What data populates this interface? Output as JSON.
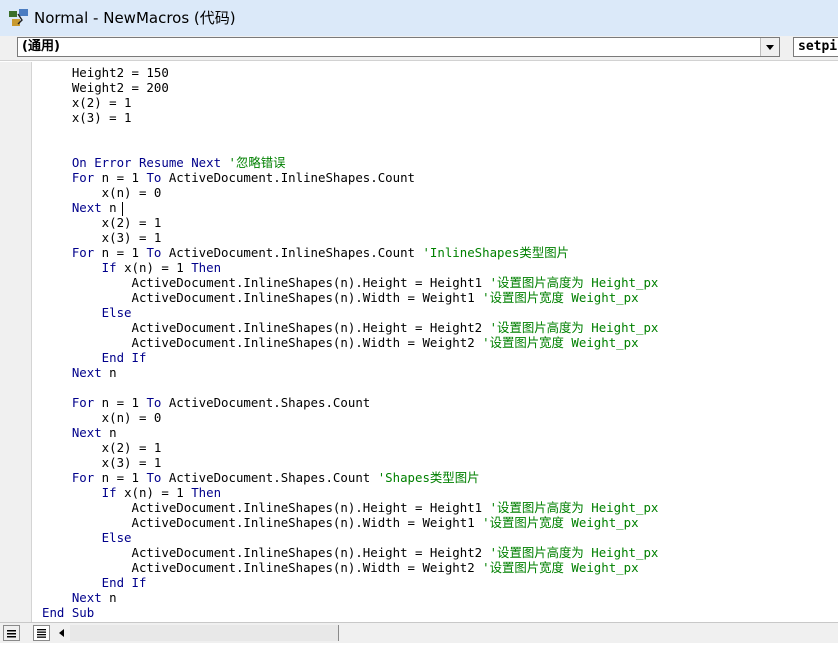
{
  "window": {
    "title": "Normal - NewMacros (代码)",
    "icon": "vba-module-icon"
  },
  "toolbar": {
    "object_combo": {
      "value": "(通用)",
      "icon": "dropdown-arrow-icon"
    },
    "procedure_combo": {
      "value": "setpi"
    }
  },
  "code": {
    "lines": [
      [
        {
          "t": "    Height2 = 150",
          "c": "n"
        }
      ],
      [
        {
          "t": "    Weight2 = 200",
          "c": "n"
        }
      ],
      [
        {
          "t": "    x(2) = 1",
          "c": "n"
        }
      ],
      [
        {
          "t": "    x(3) = 1",
          "c": "n"
        }
      ],
      [
        {
          "t": "",
          "c": "n"
        }
      ],
      [
        {
          "t": "",
          "c": "n"
        }
      ],
      [
        {
          "t": "    On Error Resume Next",
          "c": "k"
        },
        {
          "t": " '忽略错误",
          "c": "c"
        }
      ],
      [
        {
          "t": "    For",
          "c": "k"
        },
        {
          "t": " n = 1 ",
          "c": "n"
        },
        {
          "t": "To",
          "c": "k"
        },
        {
          "t": " ActiveDocument.InlineShapes.Count",
          "c": "n"
        }
      ],
      [
        {
          "t": "        x(n) = 0",
          "c": "n"
        }
      ],
      [
        {
          "t": "    Next",
          "c": "k"
        },
        {
          "t": " n",
          "c": "n"
        }
      ],
      [
        {
          "t": "        x(2) = 1",
          "c": "n"
        }
      ],
      [
        {
          "t": "        x(3) = 1",
          "c": "n"
        }
      ],
      [
        {
          "t": "    For",
          "c": "k"
        },
        {
          "t": " n = 1 ",
          "c": "n"
        },
        {
          "t": "To",
          "c": "k"
        },
        {
          "t": " ActiveDocument.InlineShapes.Count ",
          "c": "n"
        },
        {
          "t": "'InlineShapes类型图片",
          "c": "c"
        }
      ],
      [
        {
          "t": "        If",
          "c": "k"
        },
        {
          "t": " x(n) = 1 ",
          "c": "n"
        },
        {
          "t": "Then",
          "c": "k"
        }
      ],
      [
        {
          "t": "            ActiveDocument.InlineShapes(n).Height = Height1 ",
          "c": "n"
        },
        {
          "t": "'设置图片高度为 Height_px",
          "c": "c"
        }
      ],
      [
        {
          "t": "            ActiveDocument.InlineShapes(n).Width = Weight1 ",
          "c": "n"
        },
        {
          "t": "'设置图片宽度 Weight_px",
          "c": "c"
        }
      ],
      [
        {
          "t": "        Else",
          "c": "k"
        }
      ],
      [
        {
          "t": "            ActiveDocument.InlineShapes(n).Height = Height2 ",
          "c": "n"
        },
        {
          "t": "'设置图片高度为 Height_px",
          "c": "c"
        }
      ],
      [
        {
          "t": "            ActiveDocument.InlineShapes(n).Width = Weight2 ",
          "c": "n"
        },
        {
          "t": "'设置图片宽度 Weight_px",
          "c": "c"
        }
      ],
      [
        {
          "t": "        End If",
          "c": "k"
        }
      ],
      [
        {
          "t": "    Next",
          "c": "k"
        },
        {
          "t": " n",
          "c": "n"
        }
      ],
      [
        {
          "t": "",
          "c": "n"
        }
      ],
      [
        {
          "t": "    For",
          "c": "k"
        },
        {
          "t": " n = 1 ",
          "c": "n"
        },
        {
          "t": "To",
          "c": "k"
        },
        {
          "t": " ActiveDocument.Shapes.Count",
          "c": "n"
        }
      ],
      [
        {
          "t": "        x(n) = 0",
          "c": "n"
        }
      ],
      [
        {
          "t": "    Next",
          "c": "k"
        },
        {
          "t": " n",
          "c": "n"
        }
      ],
      [
        {
          "t": "        x(2) = 1",
          "c": "n"
        }
      ],
      [
        {
          "t": "        x(3) = 1",
          "c": "n"
        }
      ],
      [
        {
          "t": "    For",
          "c": "k"
        },
        {
          "t": " n = 1 ",
          "c": "n"
        },
        {
          "t": "To",
          "c": "k"
        },
        {
          "t": " ActiveDocument.Shapes.Count ",
          "c": "n"
        },
        {
          "t": "'Shapes类型图片",
          "c": "c"
        }
      ],
      [
        {
          "t": "        If",
          "c": "k"
        },
        {
          "t": " x(n) = 1 ",
          "c": "n"
        },
        {
          "t": "Then",
          "c": "k"
        }
      ],
      [
        {
          "t": "            ActiveDocument.InlineShapes(n).Height = Height1 ",
          "c": "n"
        },
        {
          "t": "'设置图片高度为 Height_px",
          "c": "c"
        }
      ],
      [
        {
          "t": "            ActiveDocument.InlineShapes(n).Width = Weight1 ",
          "c": "n"
        },
        {
          "t": "'设置图片宽度 Weight_px",
          "c": "c"
        }
      ],
      [
        {
          "t": "        Else",
          "c": "k"
        }
      ],
      [
        {
          "t": "            ActiveDocument.InlineShapes(n).Height = Height2 ",
          "c": "n"
        },
        {
          "t": "'设置图片高度为 Height_px",
          "c": "c"
        }
      ],
      [
        {
          "t": "            ActiveDocument.InlineShapes(n).Width = Weight2 ",
          "c": "n"
        },
        {
          "t": "'设置图片宽度 Weight_px",
          "c": "c"
        }
      ],
      [
        {
          "t": "        End If",
          "c": "k"
        }
      ],
      [
        {
          "t": "    Next",
          "c": "k"
        },
        {
          "t": " n",
          "c": "n"
        }
      ],
      [
        {
          "t": "End Sub",
          "c": "k"
        }
      ]
    ]
  },
  "statusbar": {
    "icons": [
      "procedure-view-icon",
      "full-module-view-icon",
      "scroll-left-icon"
    ]
  },
  "colors": {
    "titlebar_bg": "#dbe9f9",
    "keyword": "#00008b",
    "comment": "#008000",
    "text": "#000000"
  }
}
